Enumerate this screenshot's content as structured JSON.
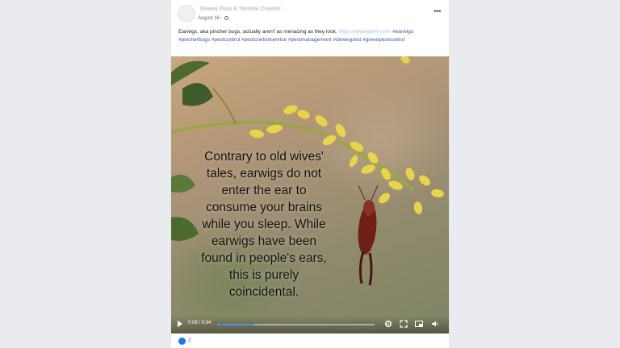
{
  "post": {
    "page_name": "Dewey Pest & Termite Control",
    "date": "August 16 ·",
    "more_label": "•••",
    "text": "Earwigs, aka pincher bugs, actually aren't as menacing as they look.",
    "link": "https://deweypest.com",
    "hashtags": [
      "#earwigs",
      "#pincherbugs",
      "#pestcontrol",
      "#pestcontrolservice",
      "#pestmanagement",
      "#deweypest",
      "#greenpestcontrol"
    ]
  },
  "video": {
    "overlay_lines": [
      "Contrary to old wives'",
      "tales, earwigs do not",
      "enter the ear to",
      "consume your brains",
      "while you sleep. While",
      "earwigs have been",
      "found in people's ears,",
      "this is purely",
      "coincidental."
    ],
    "time": "0:08 / 0:34",
    "progress": 0.235,
    "accent_color": "#4f8fe8",
    "icons": [
      "play-icon",
      "settings-icon",
      "fullscreen-icon",
      "picture-in-picture-icon",
      "volume-icon"
    ]
  },
  "footer": {
    "reaction_icon": "like-icon",
    "reaction_count": "2"
  }
}
